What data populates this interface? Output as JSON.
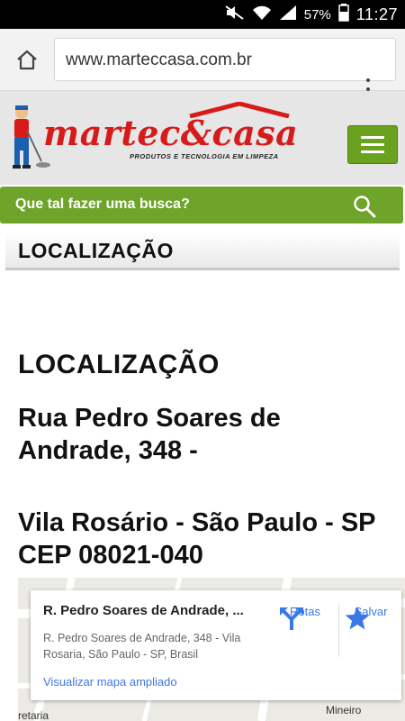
{
  "status_bar": {
    "battery": "57%",
    "time": "11:27"
  },
  "browser": {
    "url": "www.marteccasa.com.br"
  },
  "header": {
    "logo_text": "martec&casa",
    "logo_tagline": "PRODUTOS E TECNOLOGIA EM LIMPEZA"
  },
  "search": {
    "placeholder": "Que tal fazer uma busca?"
  },
  "section": {
    "bar_title": "LOCALIZAÇÃO",
    "heading": "LOCALIZAÇÃO",
    "address_line1": "Rua Pedro Soares de Andrade, 348 -",
    "address_line2": "Vila Rosário - São Paulo - SP CEP 08021-040"
  },
  "map": {
    "card_title": "R. Pedro Soares de Andrade, ...",
    "card_address": "R. Pedro Soares de Andrade, 348 - Vila Rosaria, São Paulo - SP, Brasil",
    "view_larger": "Visualizar mapa ampliado",
    "directions_label": "Rotas",
    "save_label": "Salvar",
    "labels": [
      "retaria",
      "Mineiro"
    ],
    "accent_color": "#3b78e7"
  },
  "colors": {
    "brand_green": "#6ea42a",
    "brand_red": "#d71b1b"
  }
}
